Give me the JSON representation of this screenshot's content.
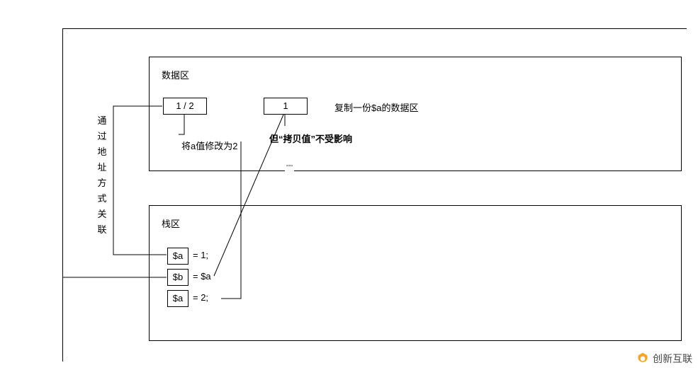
{
  "outer_box": "",
  "data_area": {
    "title": "数据区",
    "cell_a": "1 / 2",
    "cell_copy": "1",
    "copy_note": "复制一份$a的数据区",
    "modify_note": "将a值修改为2",
    "bold_note": "但“拷贝值”不受影响",
    "small_mark": "\"'\""
  },
  "stack_area": {
    "title": "栈区",
    "row1_left": "$a",
    "row1_right": "= 1;",
    "row2_left": "$b",
    "row2_right": "= $a",
    "row3_left": "$a",
    "row3_right": "= 2;"
  },
  "vlabel": "通过地址方式关联",
  "watermark": "创新互联"
}
